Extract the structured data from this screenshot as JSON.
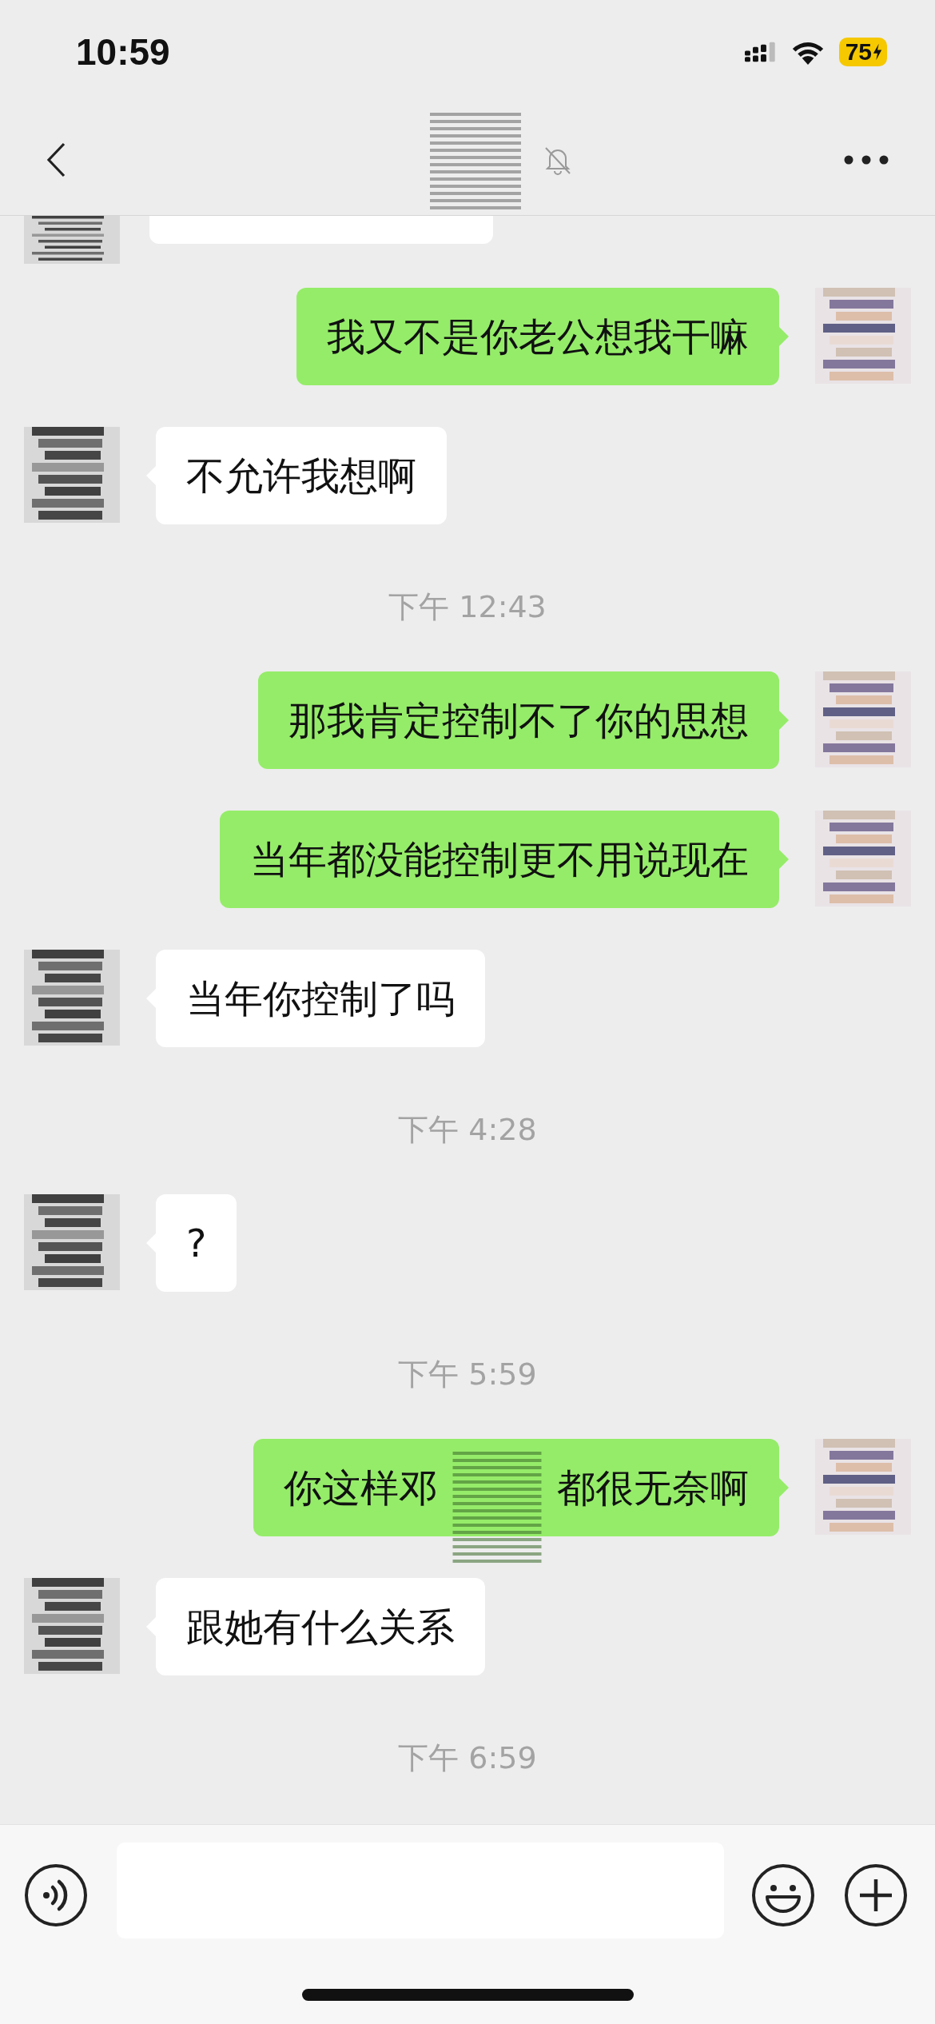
{
  "status_bar": {
    "time": "10:59",
    "battery": "75",
    "charging": true
  },
  "header": {
    "muted": true
  },
  "messages": [
    {
      "kind": "partial",
      "outgoing": false
    },
    {
      "kind": "text",
      "outgoing": true,
      "text": "我又不是你老公想我干嘛"
    },
    {
      "kind": "text",
      "outgoing": false,
      "text": "不允许我想啊"
    },
    {
      "kind": "time",
      "text": "下午 12:43"
    },
    {
      "kind": "text",
      "outgoing": true,
      "text": "那我肯定控制不了你的思想"
    },
    {
      "kind": "text",
      "outgoing": true,
      "text": "当年都没能控制更不用说现在"
    },
    {
      "kind": "text",
      "outgoing": false,
      "text": "当年你控制了吗"
    },
    {
      "kind": "time",
      "text": "下午 4:28"
    },
    {
      "kind": "text",
      "outgoing": false,
      "text": "?"
    },
    {
      "kind": "time",
      "text": "下午 5:59"
    },
    {
      "kind": "redacted",
      "outgoing": true,
      "before": "你这样邓",
      "after": "都很无奈啊"
    },
    {
      "kind": "text",
      "outgoing": false,
      "text": "跟她有什么关系"
    },
    {
      "kind": "time",
      "text": "下午 6:59"
    }
  ]
}
